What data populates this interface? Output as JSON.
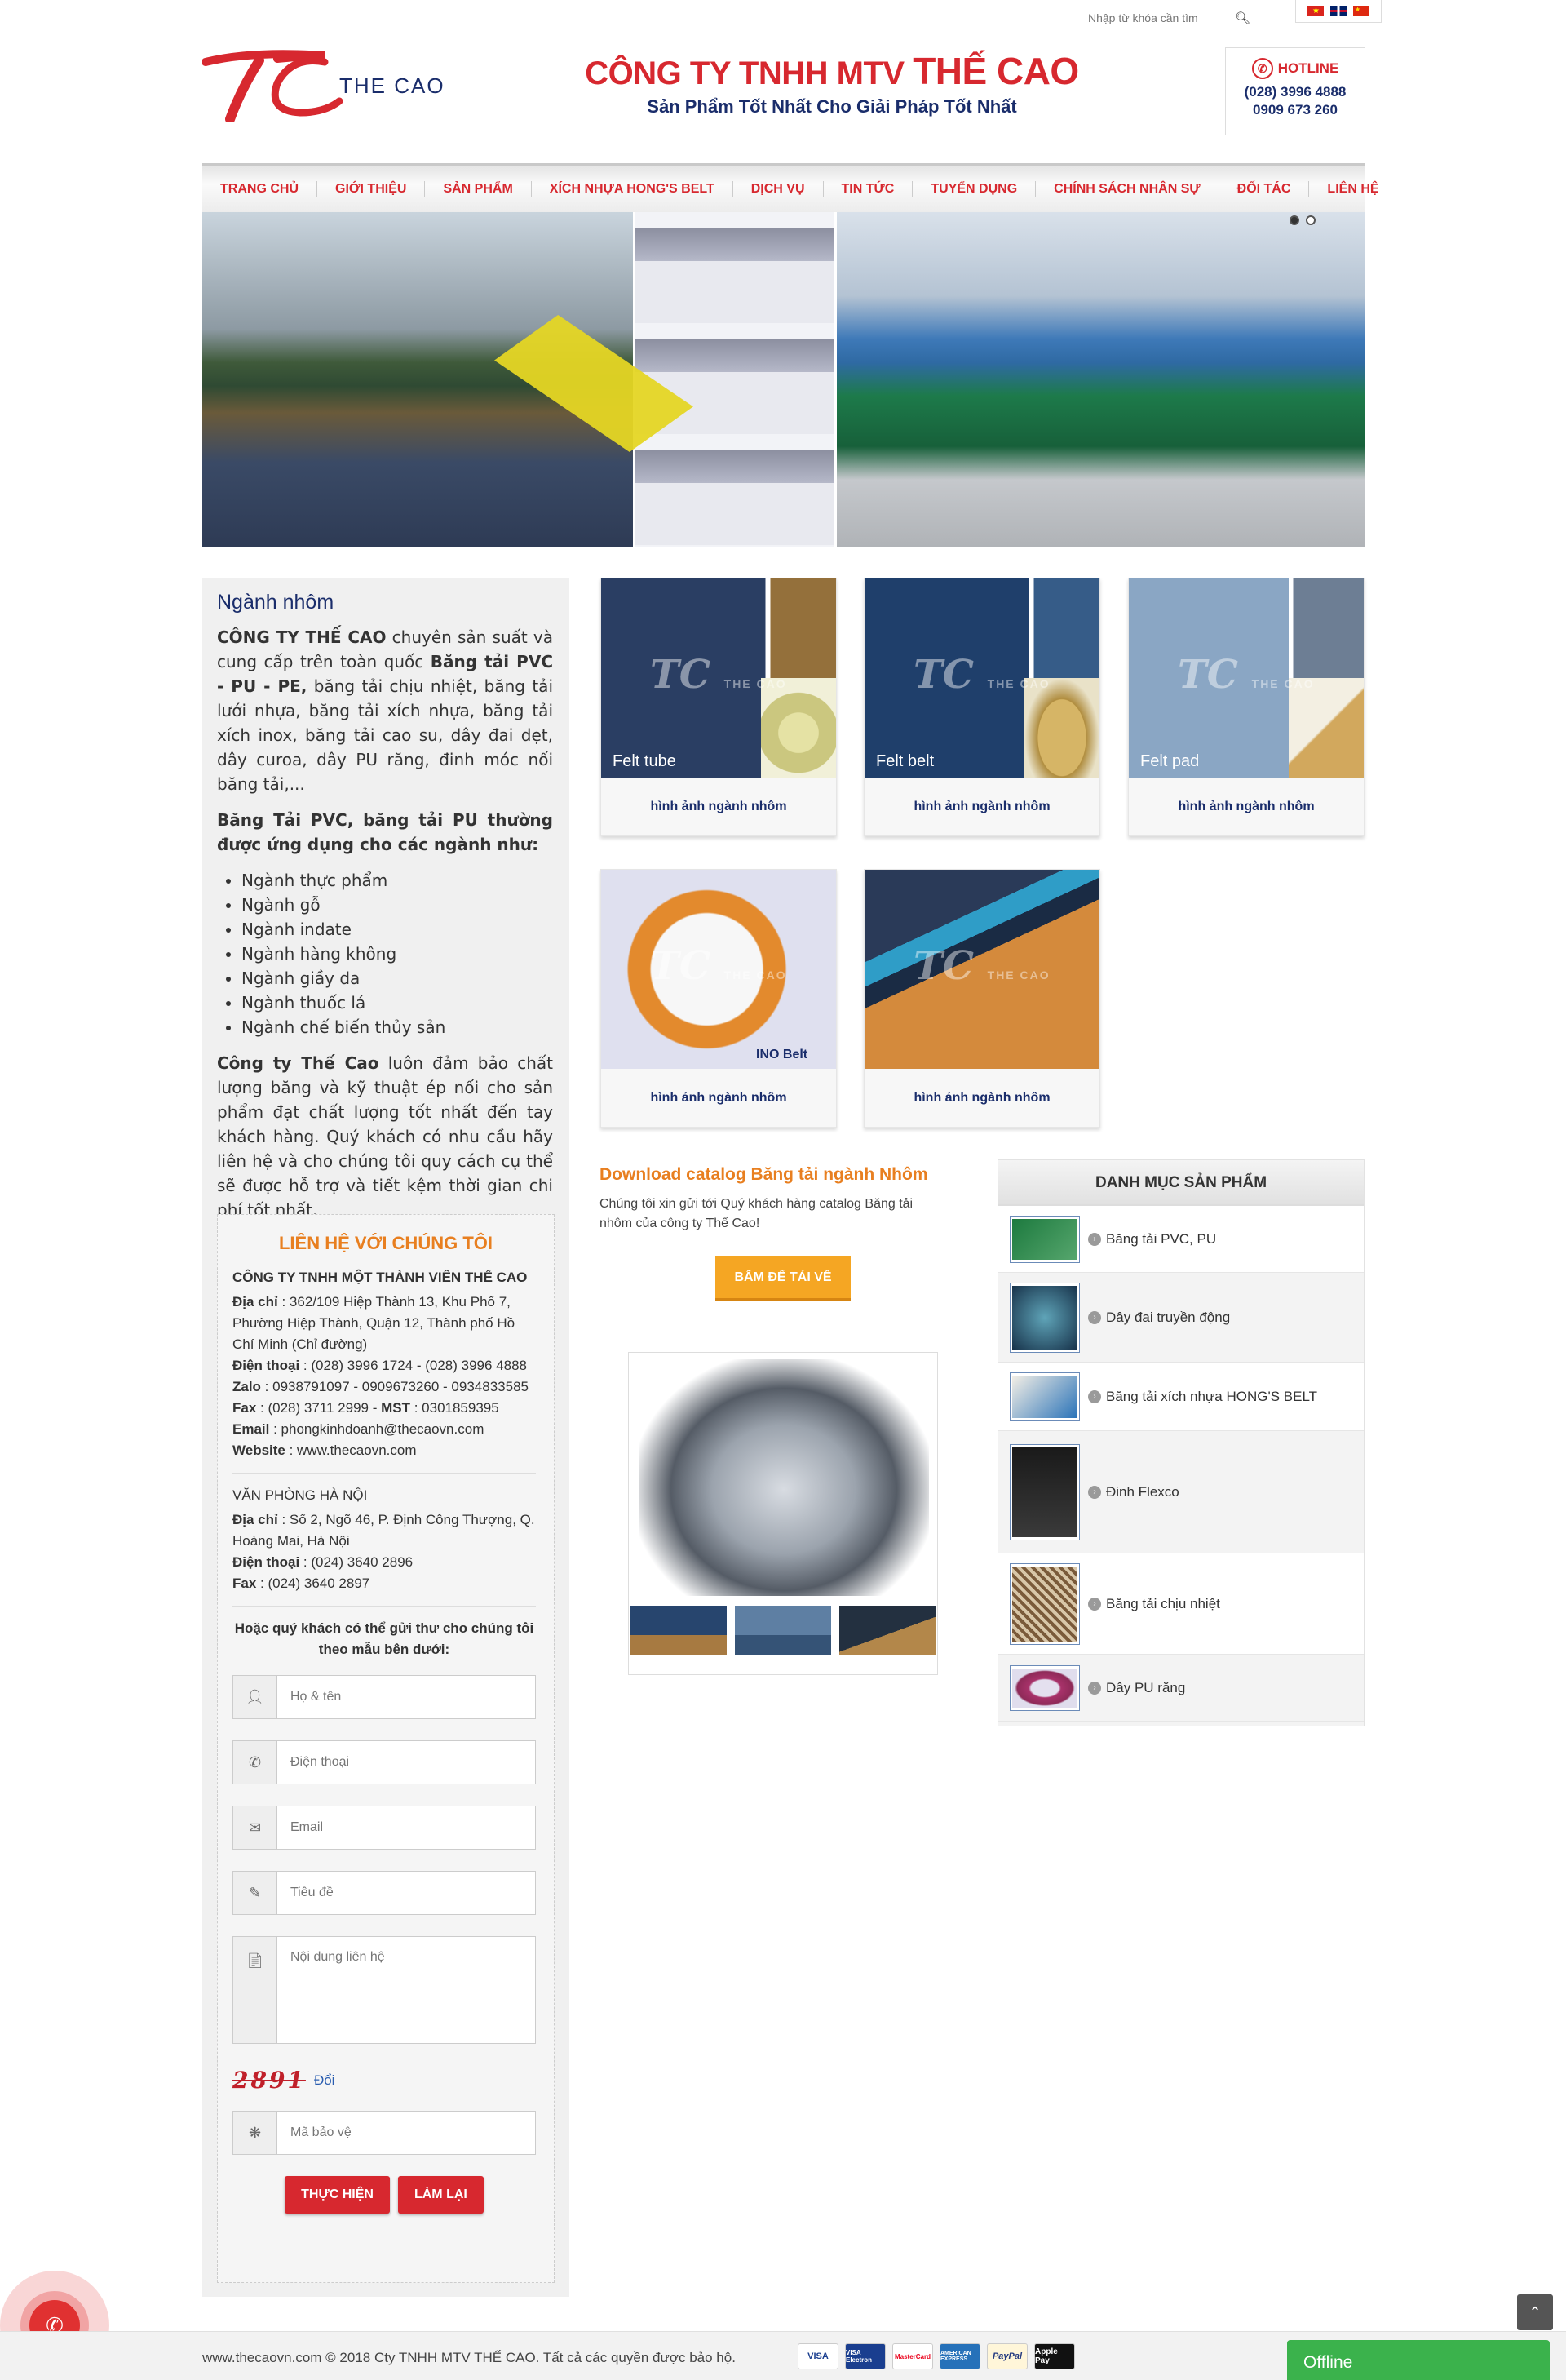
{
  "top": {
    "search_placeholder": "Nhập từ khóa cần tìm",
    "languages": [
      "vietnamese",
      "english",
      "chinese"
    ]
  },
  "header": {
    "logo_text": "THE CAO",
    "company_prefix": "CÔNG TY TNHH MTV",
    "company_name": "THẾ CAO",
    "slogan": "Sản Phẩm Tốt Nhất Cho Giải Pháp Tốt Nhất",
    "hotline_label": "HOTLINE",
    "hotline_1": "(028) 3996 4888",
    "hotline_2": "0909 673 260"
  },
  "nav": [
    "TRANG CHỦ",
    "GIỚI THIỆU",
    "SẢN PHẨM",
    "XÍCH NHỰA HONG'S BELT",
    "DỊCH VỤ",
    "TIN TỨC",
    "TUYỂN DỤNG",
    "CHÍNH SÁCH NHÂN SỰ",
    "ĐỐI TÁC",
    "LIÊN HỆ"
  ],
  "sidebar": {
    "title": "Ngành nhôm",
    "p1_bold": "CÔNG TY THẾ CAO",
    "p1_mid": " chuyên sản suất và cung cấp trên toàn quốc ",
    "p1_bold2": "Băng tải PVC - PU - PE,",
    "p1_rest": " băng tải chịu nhiệt, băng tải lưới nhựa, băng tải xích nhựa, băng tải xích inox, băng tải cao su, dây đai dẹt, dây curoa, dây PU răng, đinh móc nối băng tải,...",
    "p2": "Băng Tải PVC, băng tải PU thường được ứng dụng cho các ngành như:",
    "industries": [
      "Ngành thực phẩm",
      "Ngành gỗ",
      "Ngành indate",
      "Ngành hàng không",
      "Ngành giầy da",
      "Ngành thuốc lá",
      "Ngành chế biến thủy sản"
    ],
    "p3_bold": "Công ty Thế Cao",
    "p3_rest": " luôn đảm bảo chất lượng băng và kỹ thuật ép nối cho sản phẩm đạt chất lượng tốt nhất đến tay khách hàng. Quý khách có nhu cầu hãy liên hệ và cho chúng tôi quy cách cụ thể sẽ được hỗ trợ và tiết kệm thời gian chi phí tốt nhất."
  },
  "contact": {
    "title": "LIÊN HỆ VỚI CHÚNG TÔI",
    "company": "CÔNG TY TNHH MỘT THÀNH VIÊN THẾ CAO",
    "addr_label": "Địa chỉ",
    "addr": " : 362/109 Hiệp Thành 13, Khu Phố 7, Phường Hiệp Thành, Quận 12, Thành phố Hồ Chí Minh (Chỉ đường)",
    "phone_label": "Điện thoại",
    "phone": " : (028) 3996 1724  -  (028) 3996 4888",
    "zalo_label": "Zalo",
    "zalo": " : 0938791097 - 0909673260 - 0934833585",
    "fax_label": "Fax",
    "fax": " : (028) 3711 2999  -  ",
    "mst_label": "MST",
    "mst": " : 0301859395",
    "email_label": "Email",
    "email": " : phongkinhdoanh@thecaovn.com",
    "web_label": "Website",
    "web": " : www.thecaovn.com",
    "hn_title": "VĂN PHÒNG HÀ NỘI",
    "hn_addr": " : Số 2, Ngõ 46, P. Định Công Thượng, Q. Hoàng Mai, Hà Nội",
    "hn_phone": " : (024) 3640 2896",
    "hn_fax": " : (024) 3640 2897",
    "intro": "Hoặc quý khách có thể gửi thư cho chúng tôi theo mẫu bên dưới:",
    "ph_name": "Họ & tên",
    "ph_phone": "Điện thoại",
    "ph_email": "Email",
    "ph_subject": "Tiêu đề",
    "ph_message": "Nội dung liên hệ",
    "captcha_code": "2891",
    "captcha_refresh": "Đổi",
    "ph_captcha": "Mã bảo vệ",
    "submit": "THỰC HIỆN",
    "reset": "LÀM LẠI"
  },
  "products": [
    {
      "caption": "hình ảnh ngành nhôm",
      "tag": "Felt tube"
    },
    {
      "caption": "hình ảnh ngành nhôm",
      "tag": "Felt belt"
    },
    {
      "caption": "hình ảnh ngành nhôm",
      "tag": "Felt pad"
    },
    {
      "caption": "hình ảnh ngành nhôm",
      "tag": "INO Belt"
    },
    {
      "caption": "hình ảnh ngành nhôm",
      "tag": ""
    }
  ],
  "download": {
    "title": "Download catalog Băng tải ngành Nhôm",
    "text": "Chúng tôi xin gửi tới Quý khách hàng catalog Băng tải nhôm của công ty Thế Cao!",
    "button": "BẤM ĐỂ TẢI VỀ"
  },
  "category": {
    "title": "DANH MỤC SẢN PHẨM",
    "items": [
      "Băng tải PVC, PU",
      "Dây đai truyền động",
      "Băng tải xích nhựa HONG'S BELT",
      "Đinh Flexco",
      "Băng tải chịu nhiệt",
      "Dây PU răng"
    ]
  },
  "footer": {
    "copyright": "www.thecaovn.com © 2018 Cty TNHH MTV THẾ CAO. Tất cả các quyền được bảo hộ.",
    "payments": [
      "VISA",
      "VISA Electron",
      "MasterCard",
      "AMERICAN EXPRESS",
      "PayPal",
      "Apple Pay"
    ],
    "chat_status": "Offline"
  },
  "colors": {
    "brand_red": "#d7282f",
    "navy": "#1a2d6b",
    "orange": "#e87f20",
    "chat_green": "#3bb24c"
  }
}
